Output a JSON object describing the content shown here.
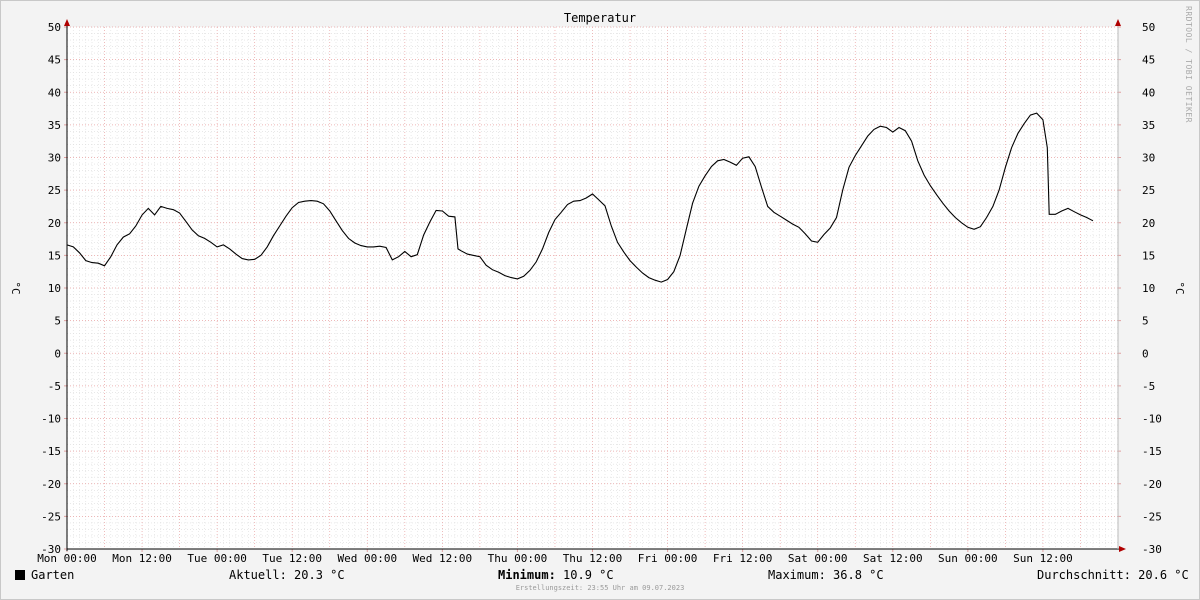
{
  "chart_data": {
    "type": "line",
    "title": "Temperatur",
    "ylabel": "°C",
    "ylim": [
      -30,
      50
    ],
    "yticks": [
      -30,
      -25,
      -20,
      -15,
      -10,
      -5,
      0,
      5,
      10,
      15,
      20,
      25,
      30,
      35,
      40,
      45,
      50
    ],
    "xlim": [
      0,
      168
    ],
    "xticks": [
      {
        "t": 0,
        "label": "Mon 00:00"
      },
      {
        "t": 12,
        "label": "Mon 12:00"
      },
      {
        "t": 24,
        "label": "Tue 00:00"
      },
      {
        "t": 36,
        "label": "Tue 12:00"
      },
      {
        "t": 48,
        "label": "Wed 00:00"
      },
      {
        "t": 60,
        "label": "Wed 12:00"
      },
      {
        "t": 72,
        "label": "Thu 00:00"
      },
      {
        "t": 84,
        "label": "Thu 12:00"
      },
      {
        "t": 96,
        "label": "Fri 00:00"
      },
      {
        "t": 108,
        "label": "Fri 12:00"
      },
      {
        "t": 120,
        "label": "Sat 00:00"
      },
      {
        "t": 132,
        "label": "Sat 12:00"
      },
      {
        "t": 144,
        "label": "Sun 00:00"
      },
      {
        "t": 156,
        "label": "Sun 12:00"
      }
    ],
    "grid": true,
    "series": [
      {
        "name": "Garten",
        "color": "#000000",
        "points": [
          [
            0,
            16.6
          ],
          [
            1,
            16.3
          ],
          [
            2,
            15.4
          ],
          [
            3,
            14.2
          ],
          [
            4,
            13.9
          ],
          [
            5,
            13.8
          ],
          [
            6,
            13.4
          ],
          [
            7,
            14.8
          ],
          [
            8,
            16.6
          ],
          [
            9,
            17.8
          ],
          [
            10,
            18.3
          ],
          [
            11,
            19.5
          ],
          [
            12,
            21.2
          ],
          [
            13,
            22.2
          ],
          [
            14,
            21.2
          ],
          [
            15,
            22.5
          ],
          [
            16,
            22.2
          ],
          [
            17,
            22.0
          ],
          [
            18,
            21.5
          ],
          [
            19,
            20.2
          ],
          [
            20,
            18.9
          ],
          [
            21,
            18.0
          ],
          [
            22,
            17.6
          ],
          [
            23,
            17.0
          ],
          [
            24,
            16.3
          ],
          [
            25,
            16.6
          ],
          [
            26,
            16.0
          ],
          [
            27,
            15.2
          ],
          [
            28,
            14.5
          ],
          [
            29,
            14.3
          ],
          [
            30,
            14.4
          ],
          [
            31,
            15.0
          ],
          [
            32,
            16.3
          ],
          [
            33,
            18.0
          ],
          [
            34,
            19.5
          ],
          [
            35,
            21.0
          ],
          [
            36,
            22.3
          ],
          [
            37,
            23.1
          ],
          [
            38,
            23.3
          ],
          [
            39,
            23.4
          ],
          [
            40,
            23.3
          ],
          [
            41,
            22.9
          ],
          [
            42,
            21.8
          ],
          [
            43,
            20.3
          ],
          [
            44,
            18.8
          ],
          [
            45,
            17.6
          ],
          [
            46,
            16.9
          ],
          [
            47,
            16.5
          ],
          [
            48,
            16.3
          ],
          [
            49,
            16.3
          ],
          [
            50,
            16.4
          ],
          [
            51,
            16.2
          ],
          [
            52,
            14.3
          ],
          [
            53,
            14.8
          ],
          [
            54,
            15.6
          ],
          [
            55,
            14.8
          ],
          [
            56,
            15.1
          ],
          [
            57,
            18.1
          ],
          [
            58,
            20.1
          ],
          [
            59,
            21.9
          ],
          [
            60,
            21.8
          ],
          [
            61,
            21.0
          ],
          [
            62,
            20.9
          ],
          [
            62.5,
            16.0
          ],
          [
            63,
            15.7
          ],
          [
            64,
            15.2
          ],
          [
            65,
            15.0
          ],
          [
            66,
            14.8
          ],
          [
            67,
            13.5
          ],
          [
            68,
            12.8
          ],
          [
            69,
            12.4
          ],
          [
            70,
            11.9
          ],
          [
            71,
            11.6
          ],
          [
            72,
            11.4
          ],
          [
            73,
            11.8
          ],
          [
            74,
            12.7
          ],
          [
            75,
            14.0
          ],
          [
            76,
            16.0
          ],
          [
            77,
            18.5
          ],
          [
            78,
            20.5
          ],
          [
            79,
            21.6
          ],
          [
            80,
            22.8
          ],
          [
            81,
            23.3
          ],
          [
            82,
            23.4
          ],
          [
            83,
            23.8
          ],
          [
            84,
            24.4
          ],
          [
            85,
            23.5
          ],
          [
            86,
            22.6
          ],
          [
            87,
            19.5
          ],
          [
            88,
            17.0
          ],
          [
            89,
            15.5
          ],
          [
            90,
            14.2
          ],
          [
            91,
            13.2
          ],
          [
            92,
            12.3
          ],
          [
            93,
            11.6
          ],
          [
            94,
            11.2
          ],
          [
            95,
            10.9
          ],
          [
            96,
            11.3
          ],
          [
            97,
            12.5
          ],
          [
            98,
            15.0
          ],
          [
            99,
            19.0
          ],
          [
            100,
            23.0
          ],
          [
            101,
            25.6
          ],
          [
            102,
            27.2
          ],
          [
            103,
            28.6
          ],
          [
            104,
            29.5
          ],
          [
            105,
            29.7
          ],
          [
            106,
            29.3
          ],
          [
            107,
            28.8
          ],
          [
            108,
            29.9
          ],
          [
            109,
            30.1
          ],
          [
            110,
            28.6
          ],
          [
            111,
            25.5
          ],
          [
            112,
            22.5
          ],
          [
            113,
            21.6
          ],
          [
            114,
            21.0
          ],
          [
            115,
            20.4
          ],
          [
            116,
            19.8
          ],
          [
            117,
            19.3
          ],
          [
            118,
            18.3
          ],
          [
            119,
            17.2
          ],
          [
            120,
            17.0
          ],
          [
            121,
            18.2
          ],
          [
            122,
            19.2
          ],
          [
            123,
            20.8
          ],
          [
            124,
            25.0
          ],
          [
            125,
            28.5
          ],
          [
            126,
            30.3
          ],
          [
            127,
            31.8
          ],
          [
            128,
            33.3
          ],
          [
            129,
            34.3
          ],
          [
            130,
            34.8
          ],
          [
            131,
            34.6
          ],
          [
            132,
            33.9
          ],
          [
            133,
            34.6
          ],
          [
            134,
            34.1
          ],
          [
            135,
            32.5
          ],
          [
            136,
            29.5
          ],
          [
            137,
            27.3
          ],
          [
            138,
            25.7
          ],
          [
            139,
            24.3
          ],
          [
            140,
            23.0
          ],
          [
            141,
            21.8
          ],
          [
            142,
            20.8
          ],
          [
            143,
            20.0
          ],
          [
            144,
            19.3
          ],
          [
            145,
            19.0
          ],
          [
            146,
            19.4
          ],
          [
            147,
            20.8
          ],
          [
            148,
            22.5
          ],
          [
            149,
            25.0
          ],
          [
            150,
            28.5
          ],
          [
            151,
            31.5
          ],
          [
            152,
            33.7
          ],
          [
            153,
            35.2
          ],
          [
            154,
            36.5
          ],
          [
            155,
            36.8
          ],
          [
            156,
            35.8
          ],
          [
            156.7,
            31.5
          ],
          [
            157,
            21.3
          ],
          [
            158,
            21.3
          ],
          [
            159,
            21.8
          ],
          [
            160,
            22.2
          ],
          [
            161,
            21.7
          ],
          [
            162,
            21.2
          ],
          [
            163,
            20.8
          ],
          [
            164,
            20.3
          ]
        ]
      }
    ]
  },
  "watermark": "RRDTOOL / TOBI OETIKER",
  "legend": {
    "series_label": "Garten",
    "current_label": "Aktuell:",
    "current_value": "20.3 °C",
    "min_label": "Minimum:",
    "min_value": "10.9 °C",
    "max_label": "Maximum:",
    "max_value": "36.8 °C",
    "avg_label": "Durchschnitt:",
    "avg_value": "20.6 °C"
  },
  "footer": "Erstellungszeit: 23:55 Uhr am 09.07.2023"
}
